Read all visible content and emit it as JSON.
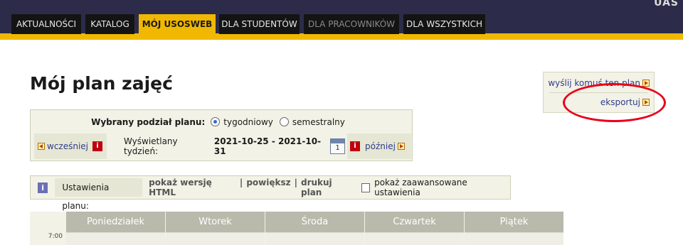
{
  "nav": {
    "tabs": [
      {
        "label": "AKTUALNOŚCI"
      },
      {
        "label": "KATALOG"
      },
      {
        "label": "MÓJ USOSWEB"
      },
      {
        "label": "DLA STUDENTÓW"
      },
      {
        "label": "DLA PRACOWNIKÓW"
      },
      {
        "label": "DLA WSZYSTKICH"
      }
    ],
    "active_tab": "MÓJ USOSWEB",
    "logo_fragment": "UAS"
  },
  "page": {
    "title": "Mój plan zajęć"
  },
  "side_links": {
    "send": "wyślij komuś ten plan",
    "export": "eksportuj"
  },
  "plan": {
    "division_label": "Wybrany podział planu:",
    "options": [
      "tygodniowy",
      "semestralny"
    ],
    "selected": "tygodniowy",
    "prev": "wcześniej",
    "next": "później",
    "week_label": "Wyświetlany tydzień:",
    "week_range": "2021-10-25 - 2021-10-31",
    "calendar_day": "1"
  },
  "settings": {
    "label": "Ustawienia planu:",
    "links": [
      "pokaż wersję HTML",
      "powiększ",
      "drukuj plan"
    ],
    "separator": "|",
    "advanced": "pokaż zaawansowane ustawienia"
  },
  "timetable": {
    "days": [
      "Poniedziałek",
      "Wtorek",
      "Środa",
      "Czwartek",
      "Piątek"
    ],
    "first_hour": "7:00"
  },
  "colors": {
    "top_bar": "#2c2c4a",
    "accent": "#f0b800",
    "link": "#2e3c8c",
    "panel": "#f2f2e6",
    "highlight": "#e8001c"
  }
}
